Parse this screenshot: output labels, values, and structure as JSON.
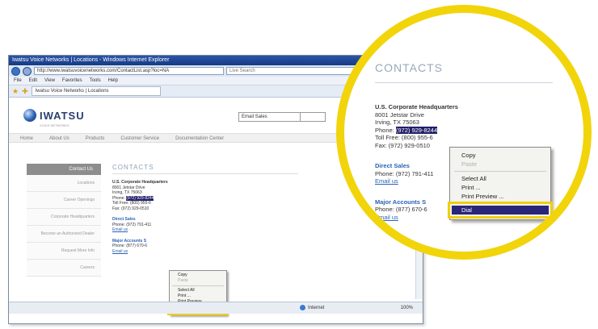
{
  "browser": {
    "title": "Iwatsu Voice Networks | Locations - Windows Internet Explorer",
    "url": "http://www.iwatsuvoicenetworks.com/ContactList.asp?loc=NA",
    "search_placeholder": "Live Search",
    "menu": [
      "File",
      "Edit",
      "View",
      "Favorites",
      "Tools",
      "Help"
    ],
    "tab_title": "Iwatsu Voice Networks | Locations",
    "status_zone": "Internet",
    "zoom": "100%"
  },
  "site": {
    "logo_text": "IWATSU",
    "logo_tagline": "VOICE NETWORKS",
    "email_box": "Email Sales",
    "nav": [
      "Home",
      "About Us",
      "Products",
      "Customer Service",
      "Documentation Center"
    ],
    "sidebar_header": "Contact Us",
    "sidebar_items": [
      "Locations",
      "Career Openings",
      "Corporate Headquarters",
      "Become an Authorized Dealer",
      "Request More Info",
      "Careers"
    ]
  },
  "contacts": {
    "title": "CONTACTS",
    "hq_name": "U.S. Corporate Headquarters",
    "hq_address1": "8001 Jetstar Drive",
    "hq_address2": "Irving, TX 75063",
    "phone_label": "Phone: ",
    "phone_number": "(972) 929-8244",
    "tollfree": "Toll Free: (800) 955-6",
    "fax": "Fax: (972) 929-0510",
    "direct_sales": "Direct Sales",
    "direct_phone": "Phone: (972) 791-411",
    "direct_email": "Email us",
    "major_accounts": "Major Accounts S",
    "major_phone": "Phone: (877) 670-6",
    "major_email": "Email us"
  },
  "context_menu": {
    "items": [
      "Copy",
      "Paste",
      "Select All",
      "Print ...",
      "Print Preview ..."
    ],
    "disabled": "Paste",
    "selected": "Dial"
  },
  "colors": {
    "highlight_yellow": "#f2d40a",
    "selection_navy": "#2a2579",
    "ie_blue": "#1d4694"
  }
}
